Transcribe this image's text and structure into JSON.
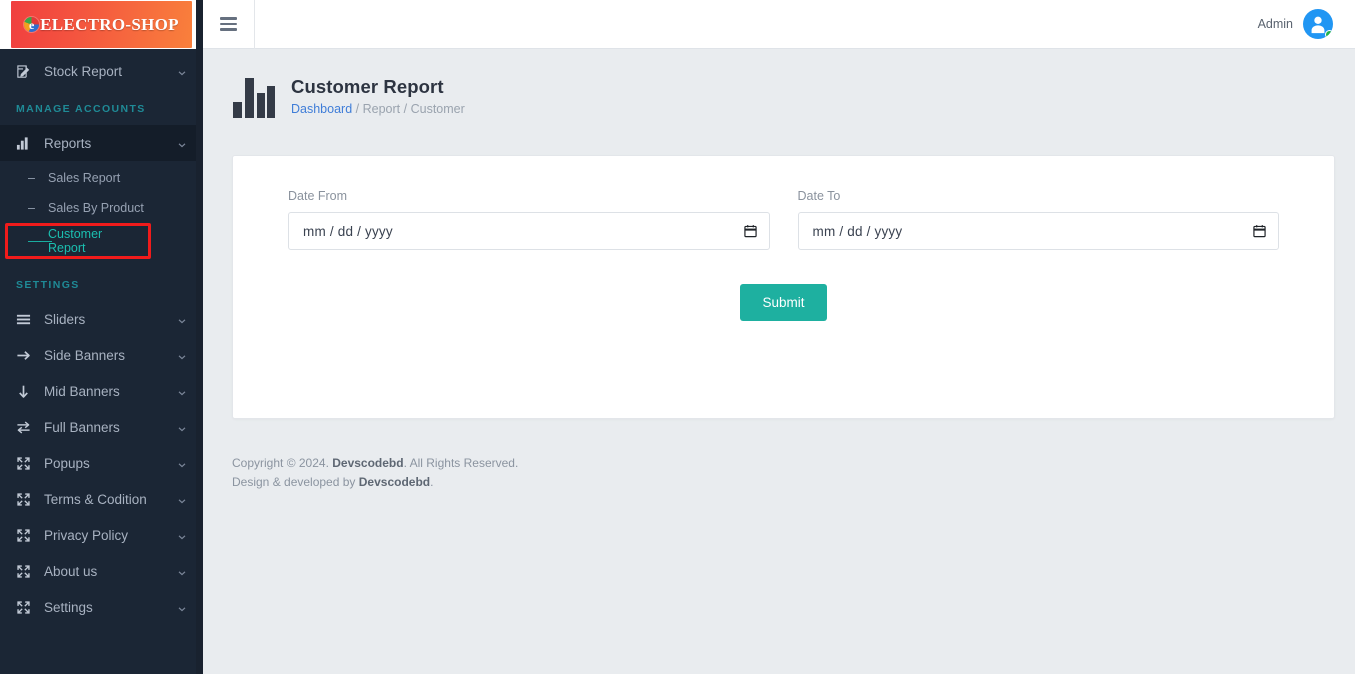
{
  "brand": {
    "logo_text": "ELECTRO-SHOP",
    "logo_mark": "e-globe-icon",
    "logo_gradient_start": "#f03f3f",
    "logo_gradient_end": "#f9803c"
  },
  "sidebar": {
    "top_items": [
      {
        "label": "Stock Report",
        "icon": "edit-square-icon",
        "chevron": "chevron-down-icon",
        "active": false
      }
    ],
    "sections": [
      {
        "title": "MANAGE ACCOUNTS",
        "items": [
          {
            "label": "Reports",
            "icon": "bar-chart-icon",
            "chevron": "chevron-down-icon",
            "active": true,
            "children": [
              {
                "label": "Sales Report",
                "marker": "–",
                "current": false,
                "highlighted": false
              },
              {
                "label": "Sales By Product",
                "marker": "–",
                "current": false,
                "highlighted": false
              },
              {
                "label": "Customer Report",
                "marker": "——",
                "current": true,
                "highlighted": true
              }
            ]
          }
        ]
      },
      {
        "title": "SETTINGS",
        "items": [
          {
            "label": "Sliders",
            "icon": "bars-icon",
            "chevron": "chevron-down-icon",
            "active": false
          },
          {
            "label": "Side Banners",
            "icon": "arrow-right-icon",
            "chevron": "chevron-down-icon",
            "active": false
          },
          {
            "label": "Mid Banners",
            "icon": "arrow-down-icon",
            "chevron": "chevron-down-icon",
            "active": false
          },
          {
            "label": "Full Banners",
            "icon": "exchange-arrows-icon",
            "chevron": "chevron-down-icon",
            "active": false
          },
          {
            "label": "Popups",
            "icon": "expand-arrows-icon",
            "chevron": "chevron-down-icon",
            "active": false
          },
          {
            "label": "Terms & Codition",
            "icon": "expand-arrows-icon",
            "chevron": "chevron-down-icon",
            "active": false
          },
          {
            "label": "Privacy Policy",
            "icon": "expand-arrows-icon",
            "chevron": "chevron-down-icon",
            "active": false
          },
          {
            "label": "About us",
            "icon": "expand-arrows-icon",
            "chevron": "chevron-down-icon",
            "active": false
          },
          {
            "label": "Settings",
            "icon": "expand-arrows-icon",
            "chevron": "chevron-down-icon",
            "active": false
          }
        ]
      }
    ],
    "highlight_color": "#f01b1b",
    "active_link_color": "#1bbfb0",
    "section_title_color": "#1f8a96"
  },
  "topbar": {
    "menu_toggle": "hamburger-icon",
    "user_name": "Admin",
    "avatar_icon": "user-avatar-icon",
    "status": "online",
    "status_color": "#24b24c"
  },
  "page": {
    "icon": "bar-chart-icon",
    "title": "Customer Report",
    "breadcrumb": {
      "root": "Dashboard",
      "sep1": "/",
      "mid": "Report",
      "sep2": "/",
      "leaf": "Customer"
    }
  },
  "form": {
    "date_from": {
      "label": "Date From",
      "placeholder": "mm / dd / yyyy",
      "value": "",
      "picker_icon": "calendar-icon"
    },
    "date_to": {
      "label": "Date To",
      "placeholder": "mm / dd / yyyy",
      "value": "",
      "picker_icon": "calendar-icon"
    },
    "submit_label": "Submit",
    "submit_color": "#1eb0a0"
  },
  "footer": {
    "line1_prefix": "Copyright © 2024. ",
    "line1_brand": "Devscodebd",
    "line1_suffix": ". All Rights Reserved.",
    "line2_prefix": "Design & developed by ",
    "line2_brand": "Devscodebd",
    "line2_suffix": "."
  }
}
